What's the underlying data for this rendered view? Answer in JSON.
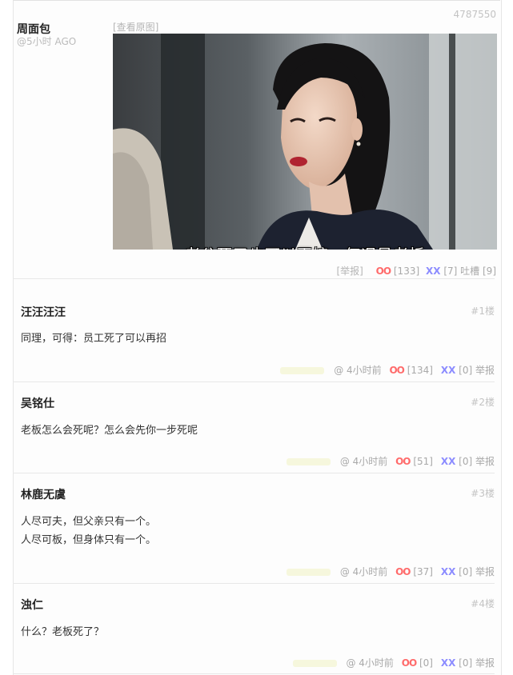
{
  "post": {
    "id": "4787550",
    "author": "周面包",
    "time": "@5小时 AGO",
    "view_original": "[查看原图]",
    "subtitle": "老公死了也可以再嫁，何况是老板",
    "report": "[举报]",
    "oo_label": "OO",
    "oo_count": "[133]",
    "xx_label": "XX",
    "xx_count": "[7]",
    "tucao_label": "吐槽",
    "tucao_count": "[9]"
  },
  "comments": [
    {
      "author": "汪汪汪汪",
      "floor": "#1楼",
      "lines": [
        "同理，可得：员工死了可以再招"
      ],
      "time": "@ 4小时前",
      "oo_label": "OO",
      "oo": "[134]",
      "xx_label": "XX",
      "xx": "[0]",
      "report": "举报"
    },
    {
      "author": "吴铭仕",
      "floor": "#2楼",
      "lines": [
        "老板怎么会死呢？怎么会先你一步死呢"
      ],
      "time": "@ 4小时前",
      "oo_label": "OO",
      "oo": "[51]",
      "xx_label": "XX",
      "xx": "[0]",
      "report": "举报"
    },
    {
      "author": "林鹿无虞",
      "floor": "#3楼",
      "lines": [
        "人尽可夫，但父亲只有一个。",
        "人尽可板，但身体只有一个。"
      ],
      "time": "@ 4小时前",
      "oo_label": "OO",
      "oo": "[37]",
      "xx_label": "XX",
      "xx": "[0]",
      "report": "举报"
    },
    {
      "author": "浊仁",
      "floor": "#4楼",
      "lines": [
        "什么？老板死了？"
      ],
      "time": "@ 4小时前",
      "oo_label": "OO",
      "oo": "[0]",
      "xx_label": "XX",
      "xx": "[0]",
      "report": "举报"
    }
  ]
}
